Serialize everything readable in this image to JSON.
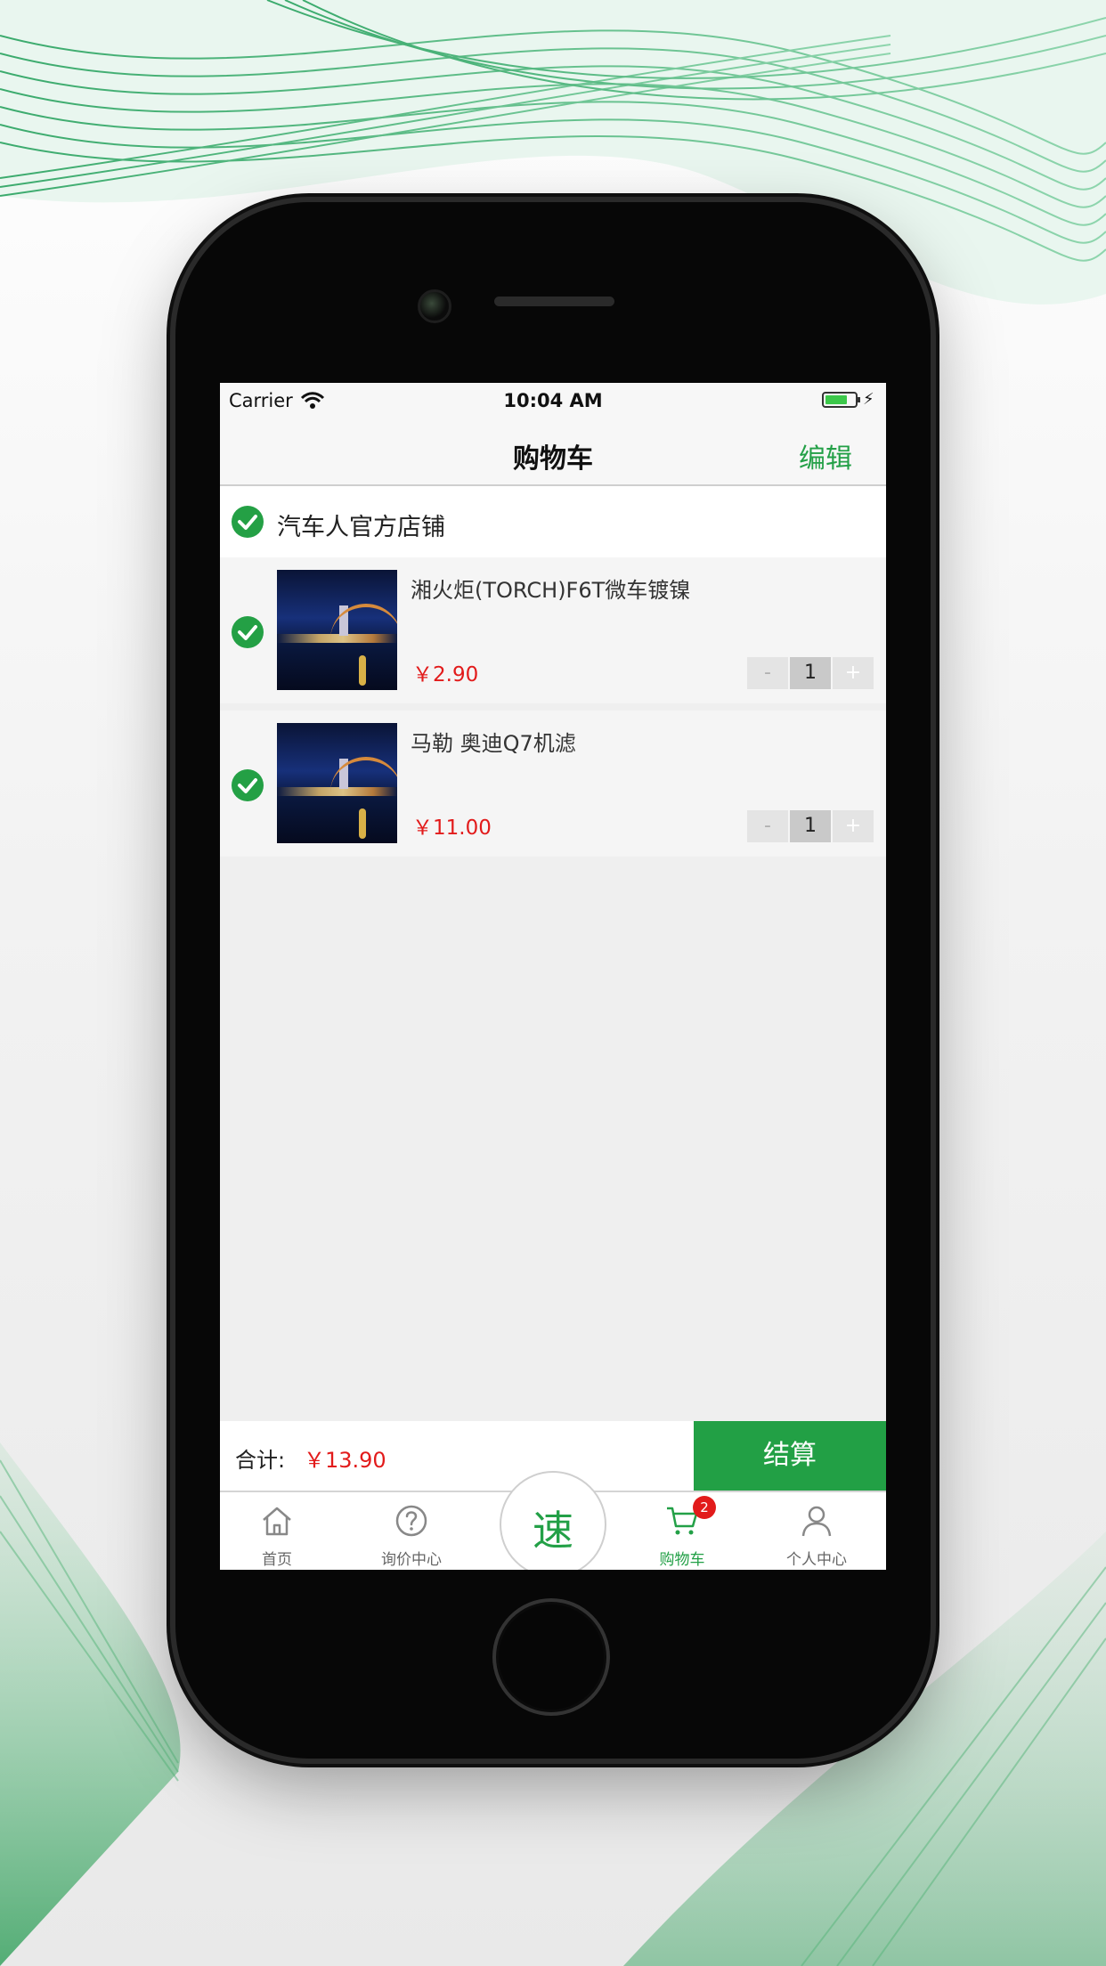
{
  "status_bar": {
    "carrier": "Carrier",
    "time": "10:04 AM",
    "icons": [
      "wifi-icon",
      "battery-icon",
      "charging-bolt-icon"
    ]
  },
  "nav": {
    "title": "购物车",
    "edit_label": "编辑"
  },
  "shop": {
    "name": "汽车人官方店铺",
    "selected": true
  },
  "items": [
    {
      "name": "湘火炬(TORCH)F6T微车镀镍",
      "price": "￥2.90",
      "quantity": "1",
      "minus": "-",
      "plus": "+",
      "selected": true
    },
    {
      "name": "马勒 奥迪Q7机滤",
      "price": "￥11.00",
      "quantity": "1",
      "minus": "-",
      "plus": "+",
      "selected": true
    }
  ],
  "total": {
    "label": "合计:",
    "amount": "￥13.90",
    "checkout_label": "结算"
  },
  "tabs": [
    {
      "label": "首页",
      "icon": "home-icon"
    },
    {
      "label": "询价中心",
      "icon": "question-icon"
    },
    {
      "label": "购物车",
      "icon": "cart-icon",
      "badge": "2",
      "active": true
    },
    {
      "label": "个人中心",
      "icon": "user-icon"
    }
  ],
  "center_button": {
    "label": "速"
  },
  "colors": {
    "accent": "#23a047",
    "price": "#e21b1b"
  }
}
